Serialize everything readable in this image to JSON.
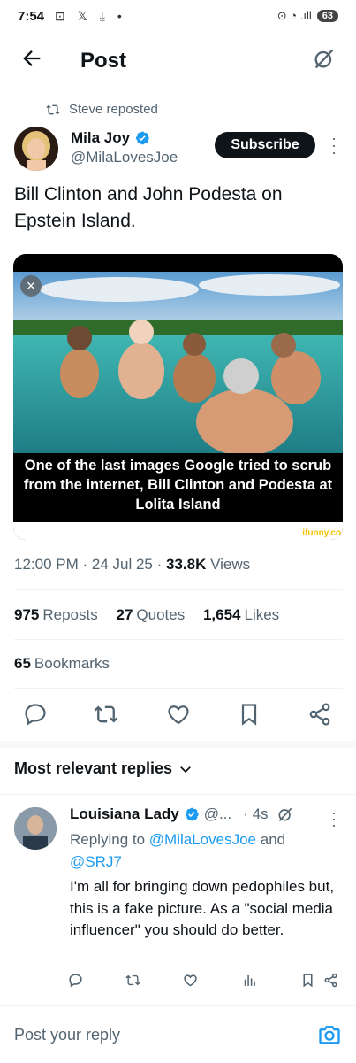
{
  "status_bar": {
    "time": "7:54",
    "icons_left": "⊡ 𝕏 ⤓ •",
    "icons_right": "⊙ ◔ .ıll",
    "battery": "63"
  },
  "header": {
    "title": "Post",
    "back_icon": "arrow-left-icon",
    "grok_icon": "grok-icon"
  },
  "repost": {
    "text": "Steve reposted"
  },
  "author": {
    "name": "Mila Joy",
    "handle": "@MilaLovesJoe",
    "subscribe_label": "Subscribe"
  },
  "post": {
    "text": "Bill Clinton and John Podesta on Epstein Island.",
    "image_caption": "One of the last images Google tried to scrub from the internet, Bill Clinton and Podesta at Lolita Island",
    "watermark": "ifunny.co",
    "time": "12:00 PM",
    "date": "24 Jul 25",
    "views": "33.8K",
    "views_label": "Views"
  },
  "stats": {
    "reposts": "975",
    "reposts_label": "Reposts",
    "quotes": "27",
    "quotes_label": "Quotes",
    "likes": "1,654",
    "likes_label": "Likes",
    "bookmarks": "65",
    "bookmarks_label": "Bookmarks"
  },
  "replies_section": {
    "title": "Most relevant replies"
  },
  "reply": {
    "name": "Louisiana Lady",
    "handle": "@...",
    "time": "· 4s",
    "replying_prefix": "Replying to",
    "replying_to_1": "@MilaLovesJoe",
    "replying_and": "and",
    "replying_to_2": "@SRJ7",
    "text": "I'm all for bringing down pedophiles but, this is a fake picture. As a \"social media influencer\" you should do better."
  },
  "compose": {
    "placeholder": "Post your reply"
  },
  "colors": {
    "accent": "#1d9bf0",
    "text": "#0f1419",
    "muted": "#536471"
  }
}
